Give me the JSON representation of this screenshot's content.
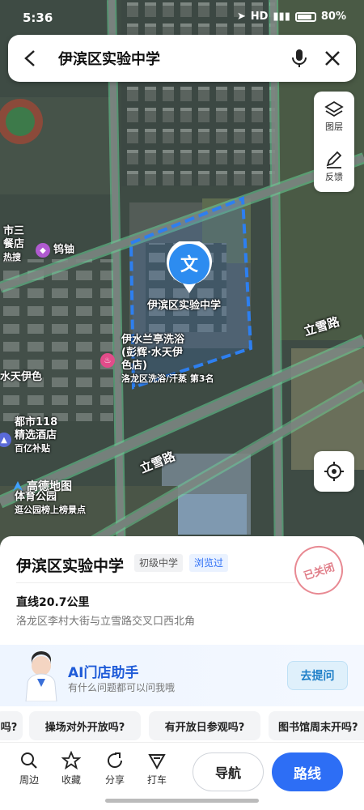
{
  "status_bar": {
    "time": "5:36",
    "network": "HD",
    "battery": "80%"
  },
  "search": {
    "query": "伊滨区实验中学"
  },
  "tools": {
    "layers_label": "图层",
    "feedback_label": "反馈"
  },
  "map": {
    "marker_char": "文",
    "marker_label": "伊滨区实验中学",
    "road_north": "立雪路",
    "road_south": "立雪路",
    "poi_left_top_line1": "市三",
    "poi_left_top_line2": "餐店",
    "poi_left_top_line3": "热搜",
    "poi_tungsten": "钨铀",
    "poi_bath_line1": "伊水兰亭洗浴",
    "poi_bath_line2": "(彭辉·水天伊",
    "poi_bath_line3": "色店)",
    "poi_bath_rank": "洛龙区洗浴/汗蒸 第3名",
    "poi_water": "水天伊色",
    "poi_hotel_line1": "都市118",
    "poi_hotel_line2": "精选酒店",
    "poi_hotel_line3": "百亿补贴",
    "poi_park_line1": "体育公园",
    "poi_park_line2": "逛公园榜上榜景点",
    "amap_logo": "高德地图",
    "colors": {
      "boundary": "#2d7ff0",
      "marker": "#2d8cf0",
      "road_outline": "#6fe0a0"
    }
  },
  "poi": {
    "title": "伊滨区实验中学",
    "category": "初级中学",
    "visited": "浏览过",
    "stamp": "已关闭",
    "distance": "直线20.7公里",
    "address": "洛龙区李村大街与立雪路交叉口西北角"
  },
  "ai": {
    "title": "AI门店助手",
    "subtitle": "有什么问题都可以问我哦",
    "button": "去提问"
  },
  "chips": [
    "吗?",
    "操场对外开放吗?",
    "有开放日参观吗?",
    "图书馆周末开吗?"
  ],
  "bottom_bar": {
    "nearby": "周边",
    "favorite": "收藏",
    "share": "分享",
    "taxi": "打车",
    "navigate": "导航",
    "route": "路线"
  }
}
